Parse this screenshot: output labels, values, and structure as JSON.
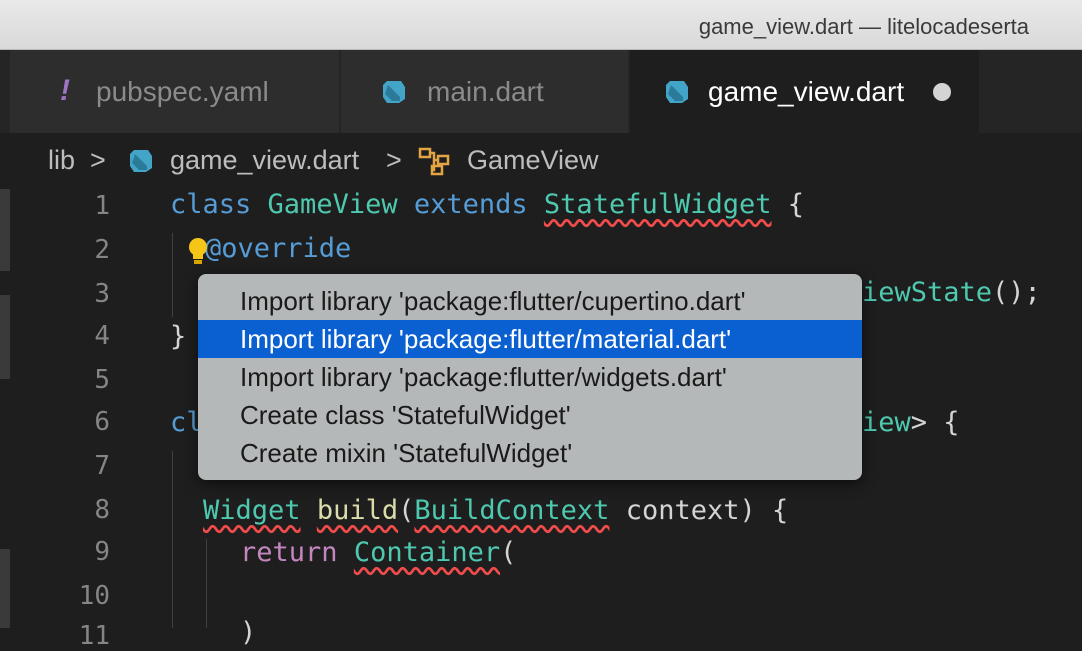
{
  "window": {
    "title": "game_view.dart — litelocadeserta"
  },
  "tabs": [
    {
      "label": "pubspec.yaml",
      "icon": "yaml-exclamation-icon",
      "active": false
    },
    {
      "label": "main.dart",
      "icon": "dart-icon",
      "active": false
    },
    {
      "label": "game_view.dart",
      "icon": "dart-icon",
      "active": true,
      "dirty": true
    }
  ],
  "breadcrumb": {
    "root": "lib",
    "separator": ">",
    "file": "game_view.dart",
    "symbol": "GameView"
  },
  "gutter": [
    "1",
    "2",
    "3",
    "4",
    "5",
    "6",
    "7",
    "8",
    "9",
    "10",
    "11"
  ],
  "code": {
    "line1": {
      "kw1": "class",
      "name": "GameView",
      "kw2": "extends",
      "type": "StatefulWidget",
      "brace": " {"
    },
    "line2": {
      "annotation": "@override"
    },
    "line3": {
      "tail_type": "iewState",
      "tail_rest": "();"
    },
    "line4": {
      "text": "}"
    },
    "line6": {
      "head": "cl",
      "tail_type": "iew",
      "tail_rest": "> {"
    },
    "line8": {
      "type1": "Widget",
      "fn": "build",
      "paren": "(",
      "type2": "BuildContext",
      "rest": " context) {"
    },
    "line9": {
      "kw": "return",
      "type": "Container",
      "rest": "("
    },
    "line11": {
      "text": ")"
    }
  },
  "quick_fix": {
    "items": [
      {
        "label": "Import library 'package:flutter/cupertino.dart'",
        "selected": false
      },
      {
        "label": "Import library 'package:flutter/material.dart'",
        "selected": true
      },
      {
        "label": "Import library 'package:flutter/widgets.dart'",
        "selected": false
      },
      {
        "label": "Create class 'StatefulWidget'",
        "selected": false
      },
      {
        "label": "Create mixin 'StatefulWidget'",
        "selected": false
      }
    ]
  },
  "colors": {
    "editor_bg": "#1e1e1e",
    "keyword": "#569cd6",
    "type": "#4ec9b0",
    "function": "#dcdcaa",
    "control": "#c586c0",
    "error_squiggle": "#f14c4c",
    "selection": "#0a5fd1",
    "dart_icon": "#42a5c8",
    "symbol_icon": "#e5a443"
  }
}
